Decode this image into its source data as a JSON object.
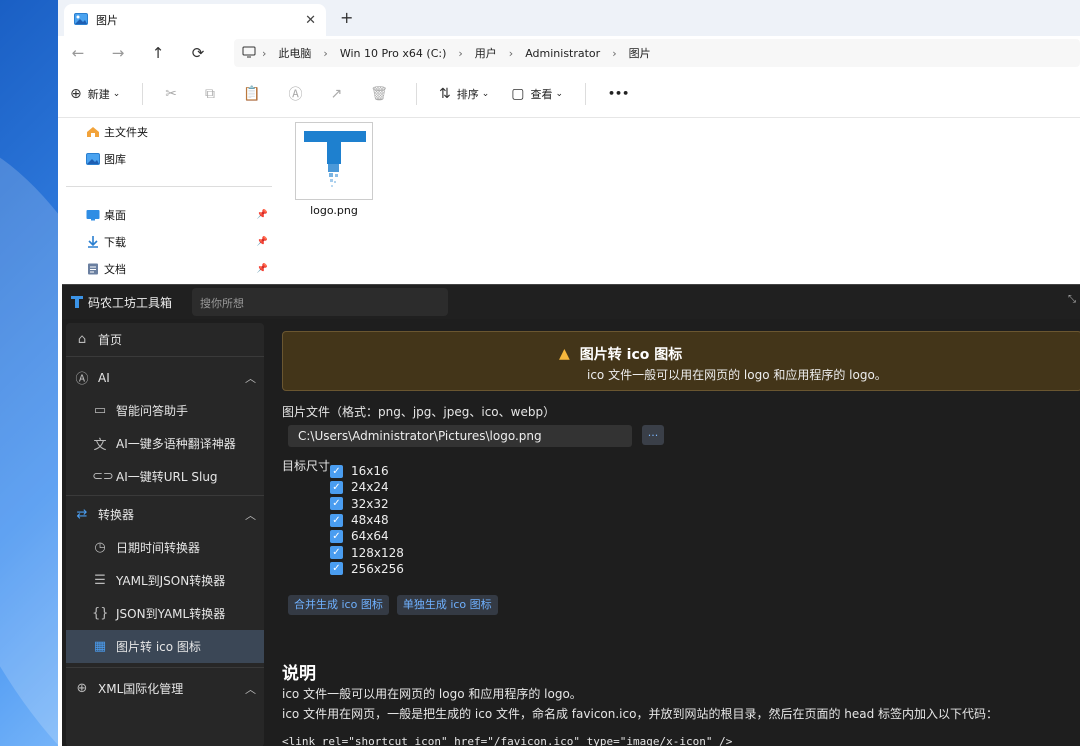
{
  "explorer": {
    "tab_title": "图片",
    "breadcrumbs": [
      "此电脑",
      "Win 10 Pro x64 (C:)",
      "用户",
      "Administrator",
      "图片"
    ],
    "toolbar": {
      "new_label": "新建",
      "sort_label": "排序",
      "view_label": "查看",
      "more_label": "•••"
    },
    "nav": {
      "top": [
        {
          "label": "主文件夹",
          "icon": "home-icon"
        },
        {
          "label": "图库",
          "icon": "gallery-icon"
        }
      ],
      "pinned": [
        {
          "label": "桌面",
          "icon": "desktop-icon"
        },
        {
          "label": "下载",
          "icon": "download-icon"
        },
        {
          "label": "文档",
          "icon": "document-icon"
        }
      ]
    },
    "file": {
      "name": "logo.png"
    }
  },
  "app": {
    "title": "码农工坊工具箱",
    "search_placeholder": "搜你所想",
    "sidebar": {
      "home": "首页",
      "ai_group": "AI",
      "ai_items": [
        "智能问答助手",
        "AI一键多语种翻译神器",
        "AI一键转URL Slug"
      ],
      "conv_group": "转换器",
      "conv_items": [
        "日期时间转换器",
        "YAML到JSON转换器",
        "JSON到YAML转换器",
        "图片转 ico 图标"
      ],
      "xml_group": "XML国际化管理"
    },
    "content": {
      "banner_title": "图片转 ico 图标",
      "banner_desc": "ico 文件一般可以用在网页的 logo 和应用程序的 logo。",
      "file_label": "图片文件（格式：png、jpg、jpeg、ico、webp）",
      "file_path": "C:\\Users\\Administrator\\Pictures\\logo.png",
      "browse_label": "...",
      "size_label": "目标尺寸",
      "sizes": [
        "16x16",
        "24x24",
        "32x32",
        "48x48",
        "64x64",
        "128x128",
        "256x256"
      ],
      "btn_merge": "合并生成 ico 图标",
      "btn_single": "单独生成 ico 图标",
      "desc_title": "说明",
      "desc_p1": "ico 文件一般可以用在网页的 logo 和应用程序的 logo。",
      "desc_p2": "ico 文件用在网页，一般是把生成的 ico 文件，命名成 favicon.ico，并放到网站的根目录，然后在页面的 head 标签内加入以下代码：",
      "code": "<link rel=\"shortcut icon\" href=\"/favicon.ico\" type=\"image/x-icon\" />"
    }
  }
}
